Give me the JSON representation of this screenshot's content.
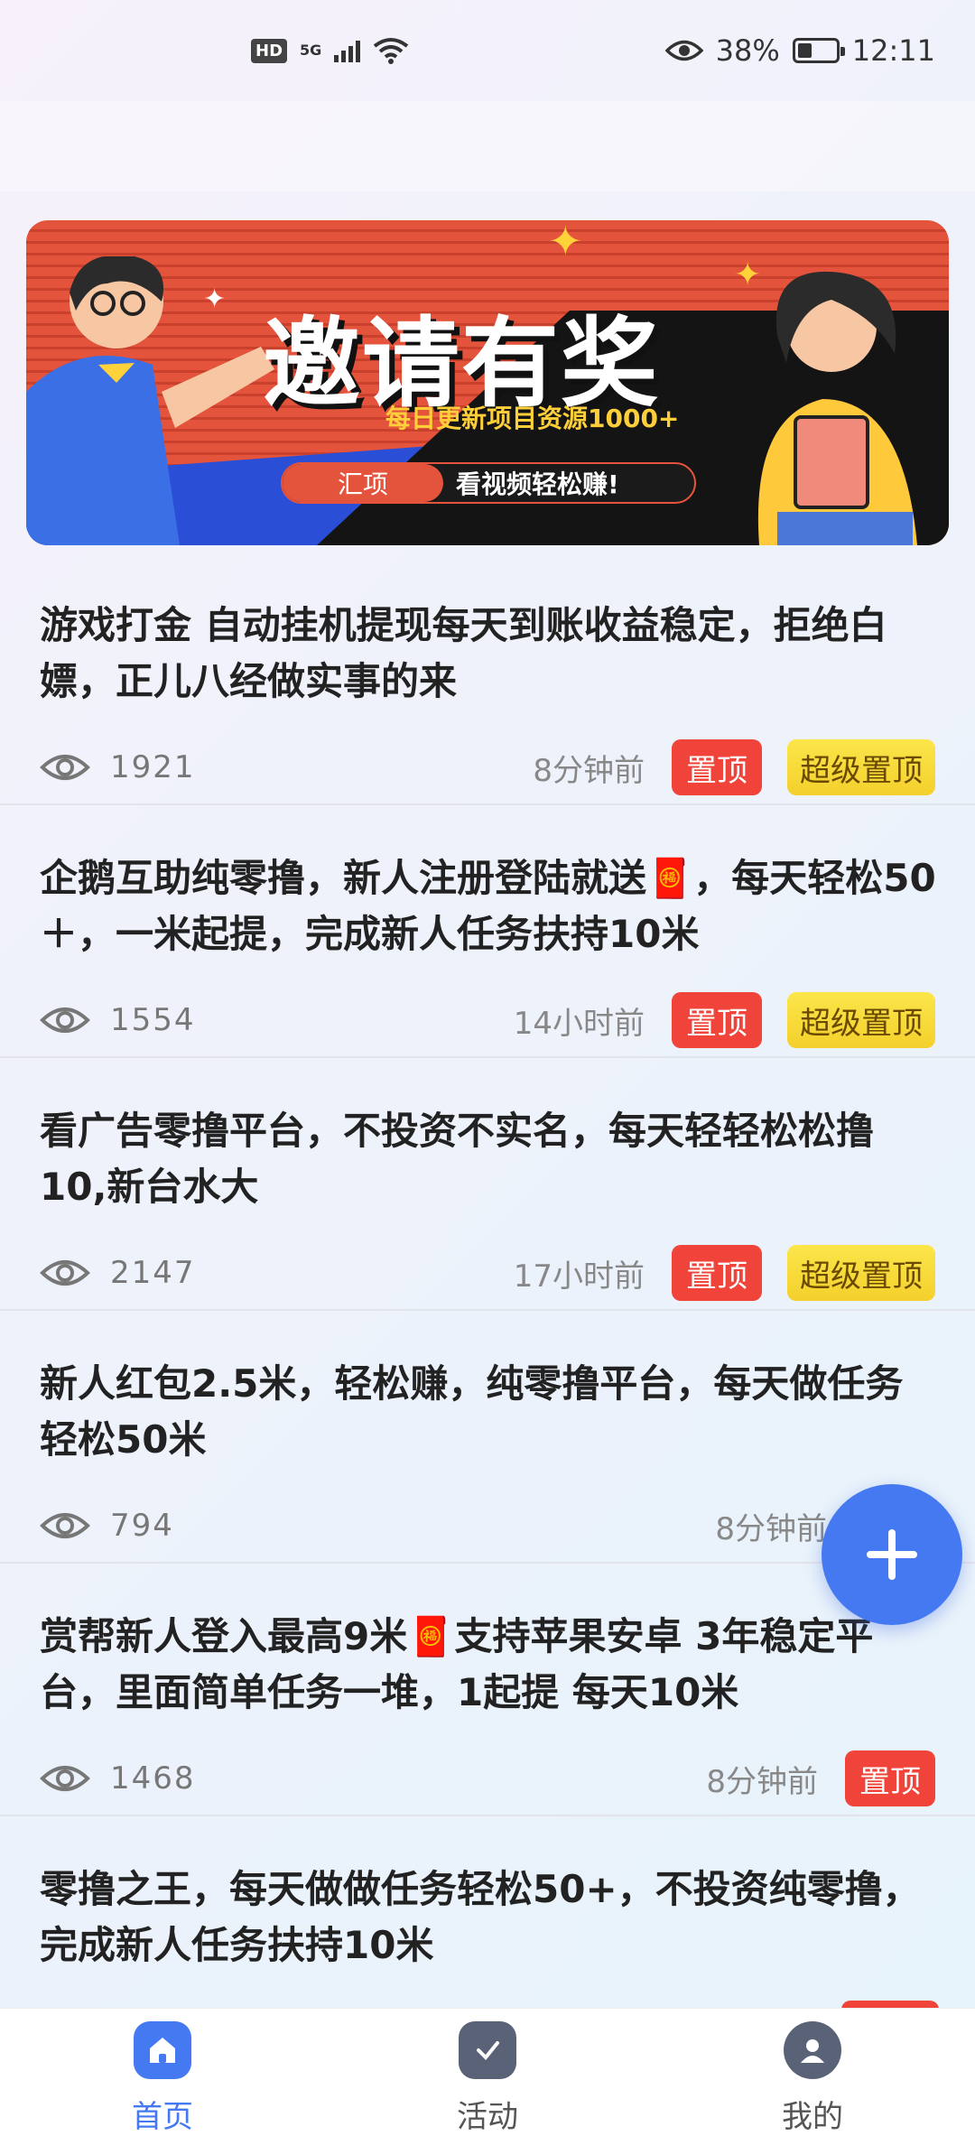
{
  "status_bar": {
    "hd": "HD",
    "network": "5G",
    "battery_percent": "38%",
    "time": "12:11",
    "battery_level": 0.38
  },
  "banner": {
    "title": "邀请有奖",
    "subtitle": "每日更新项目资源1000+",
    "tag": "汇项",
    "tagline": "看视频轻松赚!"
  },
  "posts": [
    {
      "title": "游戏打金 自动挂机提现每天到账收益稳定，拒绝白嫖，正儿八经做实事的来",
      "views": "1921",
      "time": "8分钟前",
      "tag_top": "置顶",
      "tag_super": "超级置顶"
    },
    {
      "title": "企鹅互助纯零撸，新人注册登陆就送🧧，每天轻松50＋，一米起提，完成新人任务扶持10米",
      "views": "1554",
      "time": "14小时前",
      "tag_top": "置顶",
      "tag_super": "超级置顶"
    },
    {
      "title": "看广告零撸平台，不投资不实名，每天轻轻松松撸10,新台水大",
      "views": "2147",
      "time": "17小时前",
      "tag_top": "置顶",
      "tag_super": "超级置顶"
    },
    {
      "title": "新人红包2.5米，轻松赚，纯零撸平台，每天做任务轻松50米",
      "views": "794",
      "time": "8分钟前"
    },
    {
      "title": "赏帮新人登入最高9米🧧支持苹果安卓 3年稳定平台，里面简单任务一堆，1起提 每天10米",
      "views": "1468",
      "time": "8分钟前",
      "tag_top": "置顶"
    },
    {
      "title": "零撸之王，每天做做任务轻松50+，不投资纯零撸，完成新人任务扶持10米"
    }
  ],
  "bottom_nav": {
    "home": "首页",
    "activity": "活动",
    "mine": "我的"
  },
  "colors": {
    "accent": "#4479f2",
    "tag_red": "#f0443a",
    "tag_yellow": "#f4d02c"
  }
}
